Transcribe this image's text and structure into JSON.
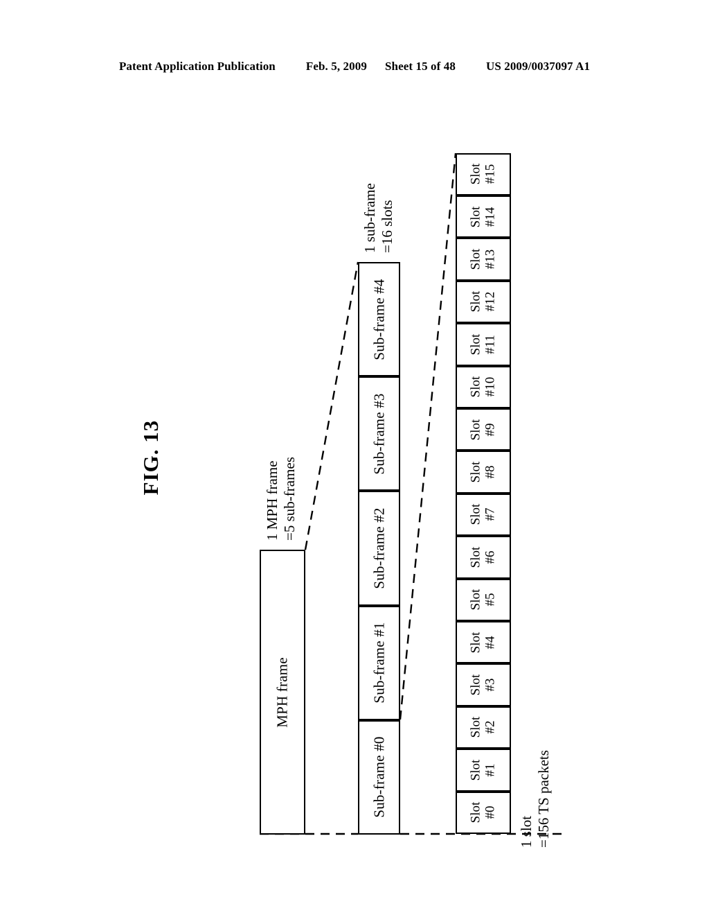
{
  "header": {
    "publication": "Patent Application Publication",
    "date": "Feb. 5, 2009",
    "sheet": "Sheet 15 of 48",
    "number": "US 2009/0037097 A1"
  },
  "figure": {
    "title": "FIG. 13",
    "mph_frame": {
      "label": "MPH frame"
    },
    "annotations": {
      "mph_frame_line1": "1 MPH frame",
      "mph_frame_line2": "=5 sub-frames",
      "sub_frame_line1": "1 sub-frame",
      "sub_frame_line2": "=16 slots",
      "slot_line1": "1 slot",
      "slot_line2": "=156 TS packets"
    },
    "sub_frames": [
      {
        "label": "Sub-frame #0"
      },
      {
        "label": "Sub-frame #1"
      },
      {
        "label": "Sub-frame #2"
      },
      {
        "label": "Sub-frame #3"
      },
      {
        "label": "Sub-frame #4"
      }
    ],
    "slots": [
      {
        "name": "Slot",
        "index": "#0"
      },
      {
        "name": "Slot",
        "index": "#1"
      },
      {
        "name": "Slot",
        "index": "#2"
      },
      {
        "name": "Slot",
        "index": "#3"
      },
      {
        "name": "Slot",
        "index": "#4"
      },
      {
        "name": "Slot",
        "index": "#5"
      },
      {
        "name": "Slot",
        "index": "#6"
      },
      {
        "name": "Slot",
        "index": "#7"
      },
      {
        "name": "Slot",
        "index": "#8"
      },
      {
        "name": "Slot",
        "index": "#9"
      },
      {
        "name": "Slot",
        "index": "#10"
      },
      {
        "name": "Slot",
        "index": "#11"
      },
      {
        "name": "Slot",
        "index": "#12"
      },
      {
        "name": "Slot",
        "index": "#13"
      },
      {
        "name": "Slot",
        "index": "#14"
      },
      {
        "name": "Slot",
        "index": "#15"
      }
    ]
  },
  "colors": {
    "ink": "#000000",
    "paper": "#ffffff"
  }
}
